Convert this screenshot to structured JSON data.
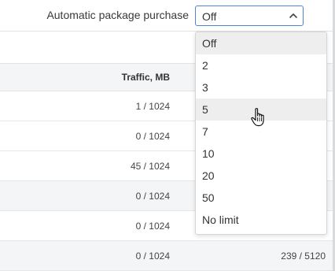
{
  "toolbar": {
    "label": "Automatic package purchase",
    "select_value": "Off"
  },
  "dropdown": {
    "options": [
      "Off",
      "2",
      "3",
      "5",
      "7",
      "10",
      "20",
      "50",
      "No limit"
    ],
    "selected": "Off",
    "hovered": "5"
  },
  "table": {
    "header_traffic": "Traffic, MB",
    "rows": [
      {
        "traffic": "1 / 1024",
        "extra": ""
      },
      {
        "traffic": "0 / 1024",
        "extra": ""
      },
      {
        "traffic": "45 / 1024",
        "extra": ""
      },
      {
        "traffic": "0 / 1024",
        "extra": ""
      },
      {
        "traffic": "0 / 1024",
        "extra": ""
      },
      {
        "traffic": "0 / 1024",
        "extra": "239 / 5120"
      }
    ]
  },
  "colors": {
    "focus_border": "#4a86d8",
    "alt_row": "#f4f5f7",
    "option_highlight": "#eeeeef"
  }
}
